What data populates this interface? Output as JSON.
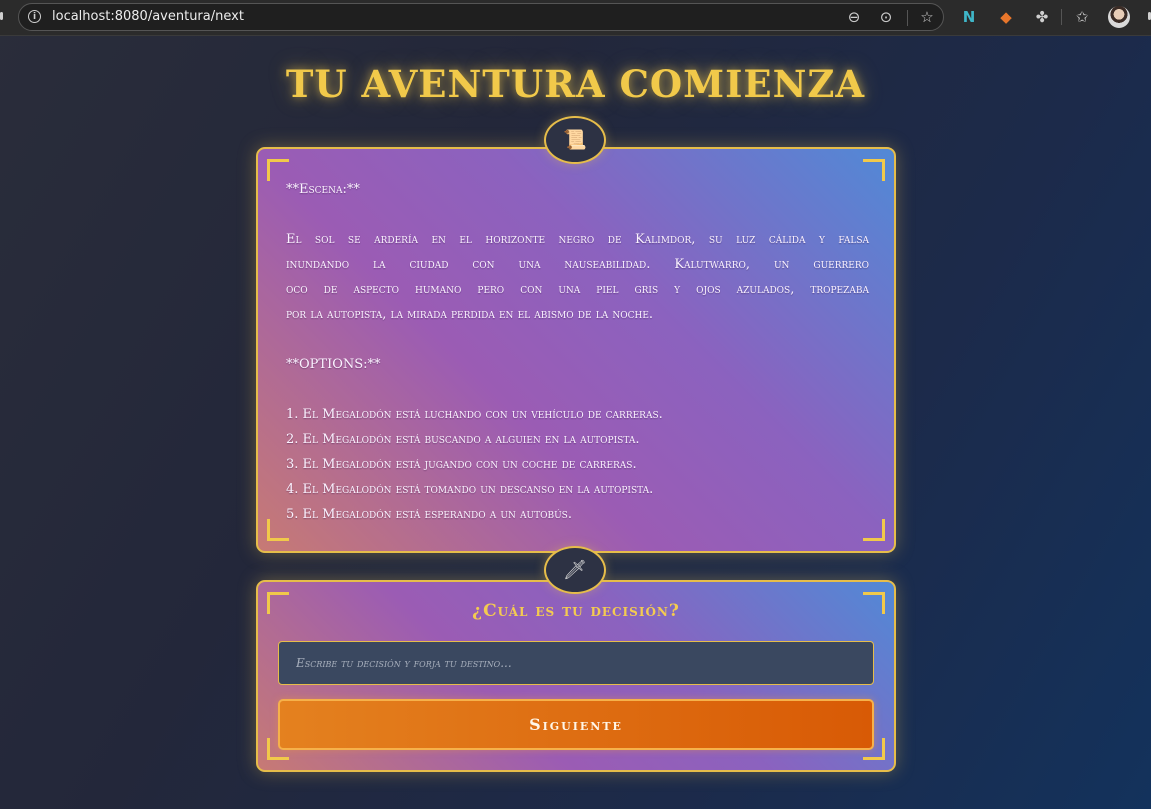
{
  "browser": {
    "url": "localhost:8080/aventura/next",
    "icons": [
      "info-icon",
      "zoom-out-icon",
      "more-icon",
      "star-icon",
      "extension-n-icon",
      "extension-fox-icon",
      "puzzle-icon",
      "favorites-icon",
      "profile-avatar"
    ]
  },
  "page": {
    "title": "Tu Aventura Comienza"
  },
  "story": {
    "badge_icon": "scroll-icon",
    "badge_glyph": "📜",
    "scene_label": "**Escena:**",
    "paragraph_lines": [
      "El sol se ardería en el horizonte negro de Kalimdor, su luz cálida y falsa",
      "inundando la ciudad con una nauseabilidad. Kalutwarro, un guerrero",
      "oco de aspecto humano pero con una piel gris y ojos azulados, tropezaba",
      "por la autopista, la mirada perdida en el abismo de la noche."
    ],
    "options_label": "**OPTIONS:**",
    "options": [
      "1. El Megalodón está luchando con un vehículo de carreras.",
      "2. El Megalodón está buscando a alguien en la autopista.",
      "3. El Megalodón está jugando con un coche de carreras.",
      "4. El Megalodón está tomando un descanso en la autopista.",
      "5. El Megalodón está esperando a un autobús."
    ]
  },
  "decision": {
    "badge_icon": "dagger-icon",
    "badge_glyph": "🗡",
    "title": "¿Cuál es tu decisión?",
    "input_value": "",
    "input_placeholder": "Escribe tu decisión y forja tu destino...",
    "button_label": "Siguiente"
  },
  "colors": {
    "accent_gold": "#f1c94a",
    "button_orange": "#e4811f",
    "card_gradient": [
      "#c77a74",
      "#9b5cb4",
      "#5189d6"
    ]
  }
}
